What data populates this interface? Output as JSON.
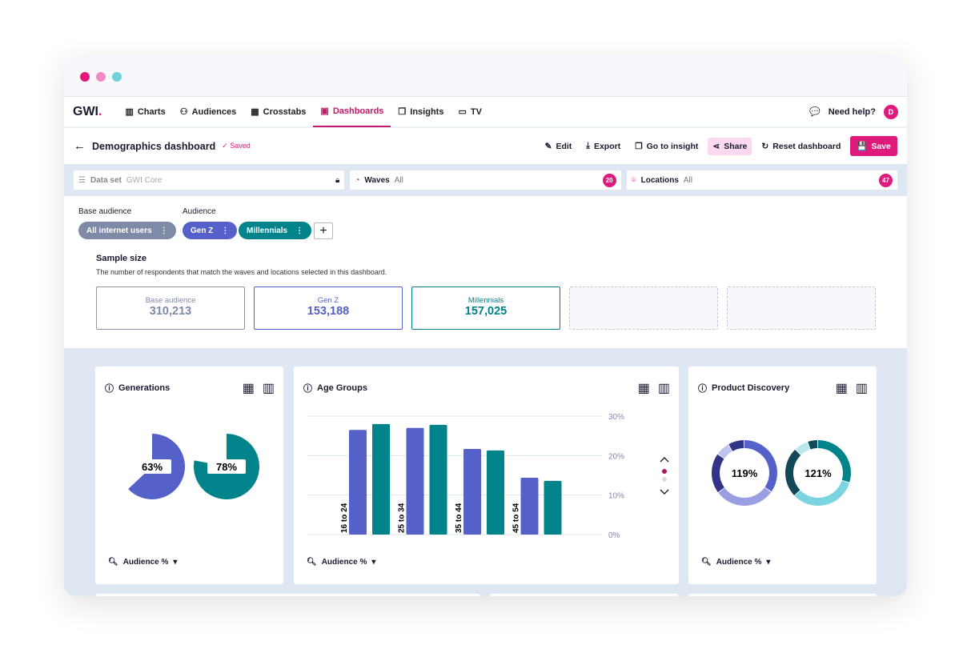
{
  "window": {
    "dots": [
      "#e0197d",
      "#f08bc3",
      "#6fd3dc"
    ]
  },
  "nav": {
    "logo": "GWI",
    "items": [
      {
        "label": "Charts",
        "icon": "bar-chart-icon"
      },
      {
        "label": "Audiences",
        "icon": "users-icon"
      },
      {
        "label": "Crosstabs",
        "icon": "table-icon"
      },
      {
        "label": "Dashboards",
        "icon": "dashboard-icon",
        "active": true
      },
      {
        "label": "Insights",
        "icon": "document-icon"
      },
      {
        "label": "TV",
        "icon": "tv-icon"
      }
    ],
    "help": "Need help?",
    "avatar": "D"
  },
  "toolbar": {
    "title": "Demographics dashboard",
    "saved": "Saved",
    "actions": {
      "edit": "Edit",
      "export": "Export",
      "go_to_insight": "Go to insight",
      "share": "Share",
      "reset": "Reset dashboard",
      "save": "Save"
    }
  },
  "filters": {
    "dataset": {
      "label": "Data set",
      "value": "GWI Core"
    },
    "waves": {
      "label": "Waves",
      "value": "All",
      "count": "20"
    },
    "locations": {
      "label": "Locations",
      "value": "All",
      "count": "47"
    }
  },
  "audiences": {
    "base_label": "Base audience",
    "audience_label": "Audience",
    "base": "All internet users",
    "items": [
      "Gen Z",
      "Millennials"
    ]
  },
  "sample": {
    "title": "Sample size",
    "description": "The number of respondents that match the waves and locations selected in this dashboard.",
    "boxes": [
      {
        "label": "Base audience",
        "value": "310,213"
      },
      {
        "label": "Gen Z",
        "value": "153,188"
      },
      {
        "label": "Millennials",
        "value": "157,025"
      }
    ]
  },
  "colors": {
    "accent": "#e0197d",
    "genz": "#5561c9",
    "millennials": "#00838a",
    "base": "#7e8aa6"
  },
  "cards": {
    "generations": {
      "title": "Generations",
      "footer": "Audience %"
    },
    "age": {
      "title": "Age Groups",
      "footer": "Audience %"
    },
    "product": {
      "title": "Product Discovery",
      "footer": "Audience %"
    }
  },
  "chart_data": [
    {
      "type": "pie",
      "title": "Generations",
      "series": [
        {
          "name": "Gen Z",
          "value": 63,
          "label": "63%"
        },
        {
          "name": "Millennials",
          "value": 78,
          "label": "78%"
        }
      ]
    },
    {
      "type": "bar",
      "title": "Age Groups",
      "categories": [
        "16 to 24",
        "25 to 34",
        "35 to 44",
        "45 to 54"
      ],
      "series": [
        {
          "name": "Gen Z",
          "values": [
            26.5,
            27,
            21.7,
            14.4
          ]
        },
        {
          "name": "Millennials",
          "values": [
            28,
            27.8,
            21.3,
            13.6
          ]
        }
      ],
      "ylim": [
        0,
        30
      ],
      "yticks": [
        "0%",
        "10%",
        "20%",
        "30%"
      ],
      "grid": true
    },
    {
      "type": "pie",
      "title": "Product Discovery",
      "donut": true,
      "series": [
        {
          "name": "Gen Z",
          "label": "119%",
          "segments": [
            35,
            30,
            20,
            7,
            8
          ],
          "colors": [
            "#5561c9",
            "#9a9fe3",
            "#333388",
            "#c0c2ef",
            "#2f3585"
          ]
        },
        {
          "name": "Millennials",
          "label": "121%",
          "segments": [
            30,
            33,
            25,
            7,
            5
          ],
          "colors": [
            "#00838a",
            "#7bd5e0",
            "#134858",
            "#b8e8ec",
            "#124b5a"
          ]
        }
      ]
    }
  ]
}
